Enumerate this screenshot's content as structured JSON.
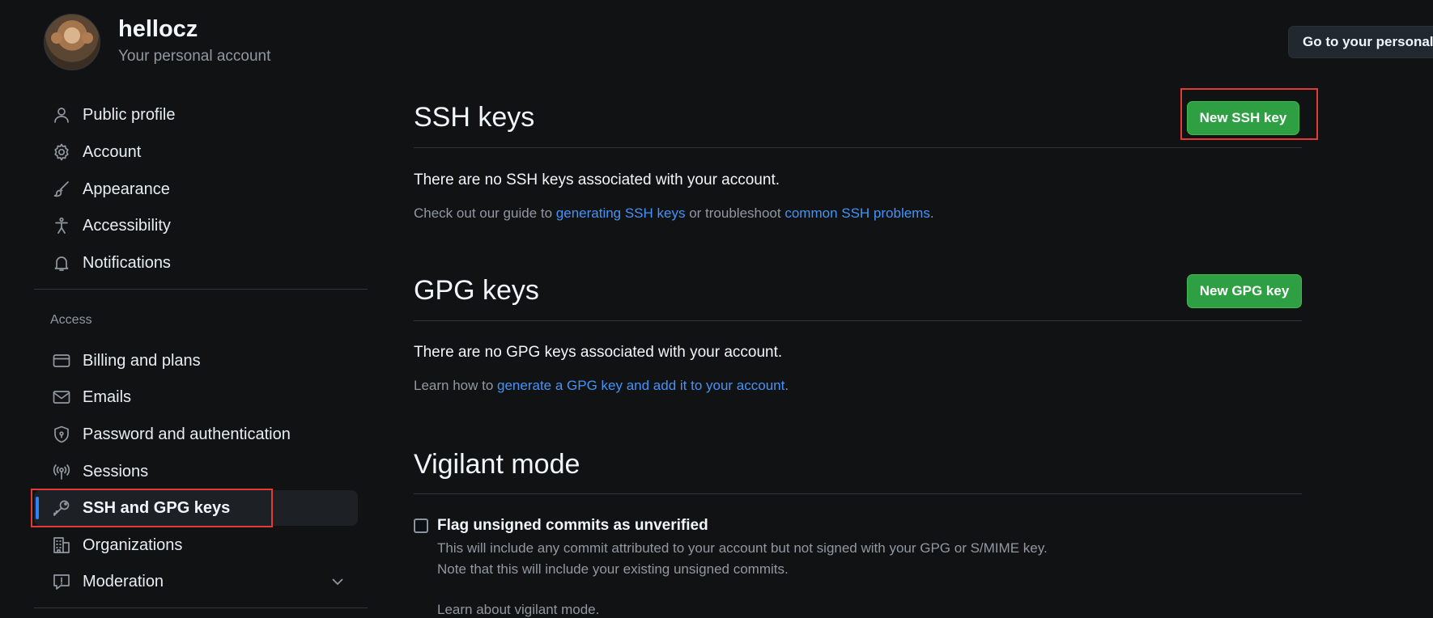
{
  "header": {
    "username": "hellocz",
    "subtitle": "Your personal account",
    "goto_button": "Go to your personal p"
  },
  "sidebar": {
    "items": [
      {
        "label": "Public profile",
        "icon": "person-icon"
      },
      {
        "label": "Account",
        "icon": "gear-icon"
      },
      {
        "label": "Appearance",
        "icon": "paintbrush-icon"
      },
      {
        "label": "Accessibility",
        "icon": "accessibility-icon"
      },
      {
        "label": "Notifications",
        "icon": "bell-icon"
      }
    ],
    "access_label": "Access",
    "access_items": [
      {
        "label": "Billing and plans",
        "icon": "credit-card-icon"
      },
      {
        "label": "Emails",
        "icon": "mail-icon"
      },
      {
        "label": "Password and authentication",
        "icon": "shield-lock-icon"
      },
      {
        "label": "Sessions",
        "icon": "broadcast-icon"
      },
      {
        "label": "SSH and GPG keys",
        "icon": "key-icon",
        "active": true
      },
      {
        "label": "Organizations",
        "icon": "organization-icon"
      },
      {
        "label": "Moderation",
        "icon": "report-icon"
      }
    ]
  },
  "ssh": {
    "title": "SSH keys",
    "button": "New SSH key",
    "empty": "There are no SSH keys associated with your account.",
    "guide_prefix": "Check out our guide to ",
    "guide_link1": "generating SSH keys",
    "guide_mid": " or troubleshoot ",
    "guide_link2": "common SSH problems",
    "guide_suffix": "."
  },
  "gpg": {
    "title": "GPG keys",
    "button": "New GPG key",
    "empty": "There are no GPG keys associated with your account.",
    "learn_prefix": "Learn how to ",
    "learn_link": "generate a GPG key and add it to your account",
    "learn_suffix": "."
  },
  "vigilant": {
    "title": "Vigilant mode",
    "checkbox_label": "Flag unsigned commits as unverified",
    "desc1": "This will include any commit attributed to your account but not signed with your GPG or S/MIME key.",
    "desc2": "Note that this will include your existing unsigned commits.",
    "link": "Learn about vigilant mode."
  },
  "colors": {
    "background": "#111214",
    "accent_green": "#2ea043",
    "link_blue": "#4493f8",
    "highlight_red": "#e53935",
    "active_bar": "#2f81f7"
  }
}
